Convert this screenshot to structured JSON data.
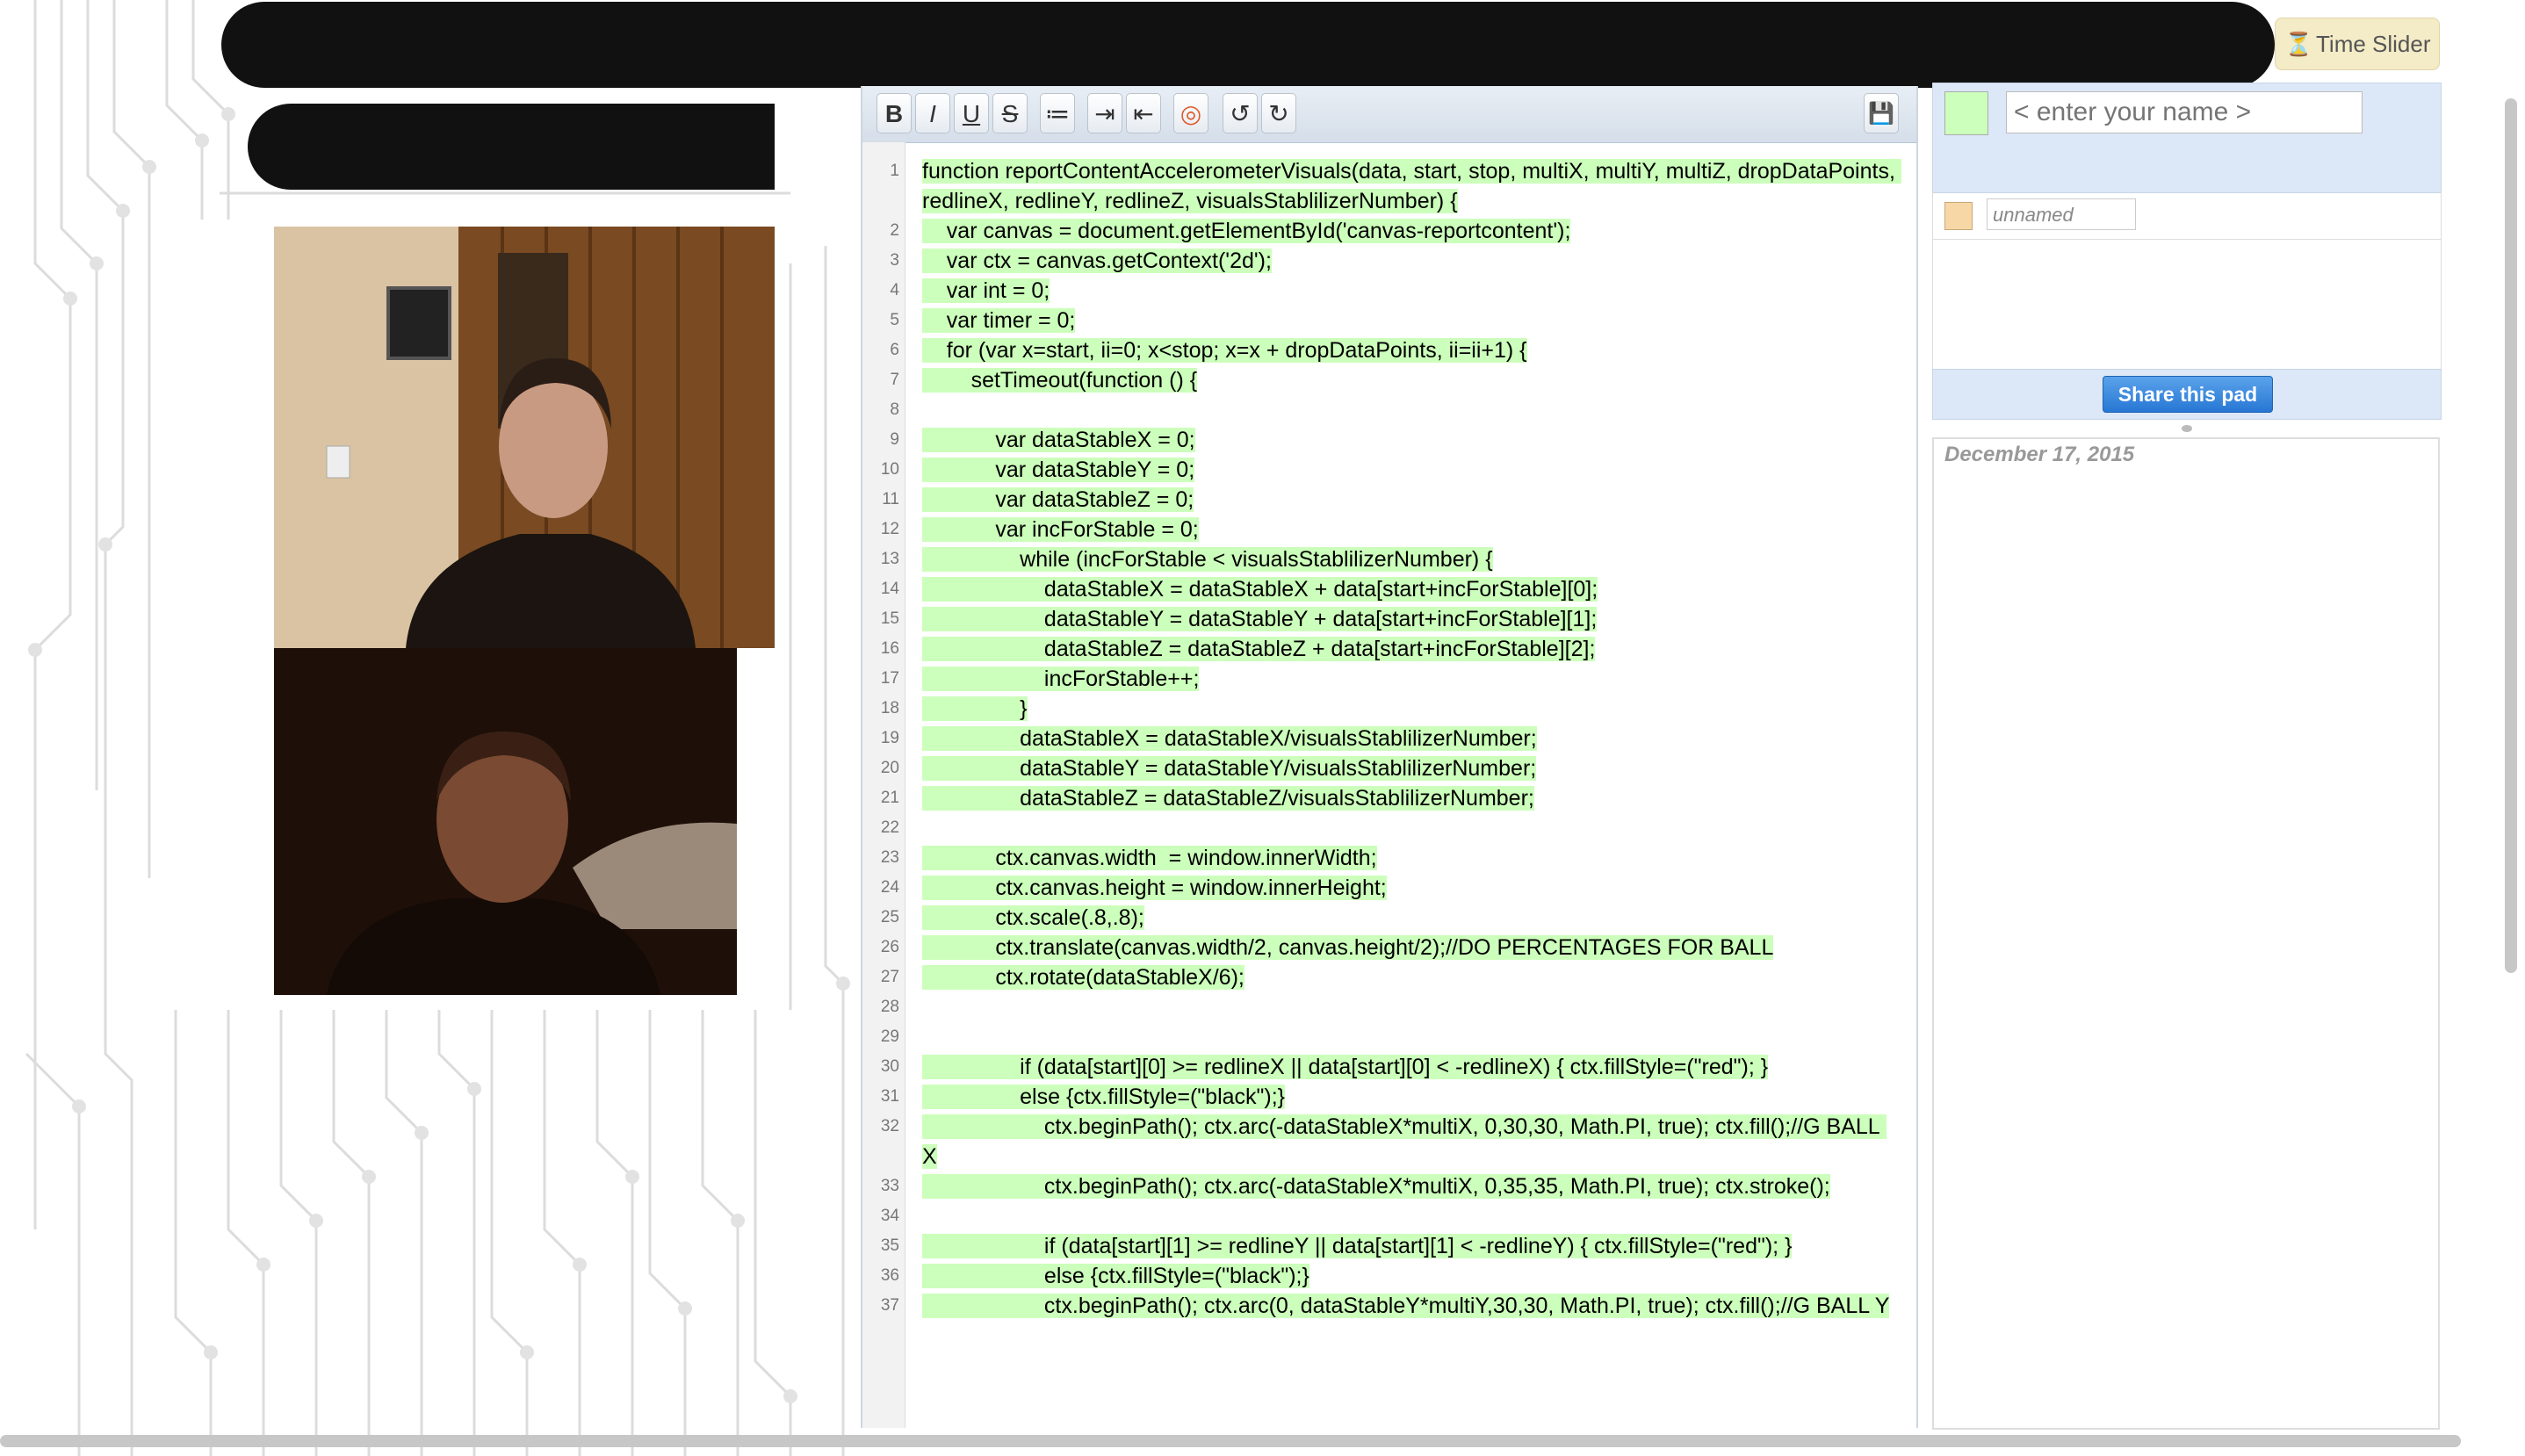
{
  "time_slider": {
    "label": "Time Slider"
  },
  "toolbar": {
    "buttons": [
      {
        "name": "bold",
        "glyph": "B"
      },
      {
        "name": "italic",
        "glyph": "I"
      },
      {
        "name": "underline",
        "glyph": "U"
      },
      {
        "name": "strikethrough",
        "glyph": "S"
      },
      {
        "name": "bullet-list",
        "glyph": "≔"
      },
      {
        "name": "indent",
        "glyph": "⇥"
      },
      {
        "name": "outdent",
        "glyph": "⇤"
      },
      {
        "name": "authorship-colors",
        "glyph": "◎"
      },
      {
        "name": "undo",
        "glyph": "↺"
      },
      {
        "name": "redo",
        "glyph": "↻"
      }
    ],
    "save_glyph": "💾"
  },
  "editor": {
    "lines": [
      {
        "n": "1",
        "text": "function reportContentAccelerometerVisuals(data, start, stop, multiX, multiY, multiZ, dropDataPoints, redlineX, redlineY, redlineZ, visualsStablilizerNumber) {"
      },
      {
        "n": "2",
        "text": "\tvar canvas = document.getElementById('canvas-reportcontent');"
      },
      {
        "n": "3",
        "text": "\tvar ctx = canvas.getContext('2d');"
      },
      {
        "n": "4",
        "text": "\tvar int = 0;"
      },
      {
        "n": "5",
        "text": "\tvar timer = 0;"
      },
      {
        "n": "6",
        "text": "\tfor (var x=start, ii=0; x<stop; x=x + dropDataPoints, ii=ii+1) {"
      },
      {
        "n": "7",
        "text": "\t\tsetTimeout(function () {"
      },
      {
        "n": "8",
        "text": ""
      },
      {
        "n": "9",
        "text": "\t\t\tvar dataStableX = 0;"
      },
      {
        "n": "10",
        "text": "\t\t\tvar dataStableY = 0;"
      },
      {
        "n": "11",
        "text": "\t\t\tvar dataStableZ = 0;"
      },
      {
        "n": "12",
        "text": "\t\t\tvar incForStable = 0;"
      },
      {
        "n": "13",
        "text": "\t\t\t\twhile (incForStable < visualsStablilizerNumber) {"
      },
      {
        "n": "14",
        "text": "\t\t\t\t\tdataStableX = dataStableX + data[start+incForStable][0];"
      },
      {
        "n": "15",
        "text": "\t\t\t\t\tdataStableY = dataStableY + data[start+incForStable][1];"
      },
      {
        "n": "16",
        "text": "\t\t\t\t\tdataStableZ = dataStableZ + data[start+incForStable][2];"
      },
      {
        "n": "17",
        "text": "\t\t\t\t\tincForStable++;"
      },
      {
        "n": "18",
        "text": "\t\t\t\t}"
      },
      {
        "n": "19",
        "text": "\t\t\t\tdataStableX = dataStableX/visualsStablilizerNumber;"
      },
      {
        "n": "20",
        "text": "\t\t\t\tdataStableY = dataStableY/visualsStablilizerNumber;"
      },
      {
        "n": "21",
        "text": "\t\t\t\tdataStableZ = dataStableZ/visualsStablilizerNumber;"
      },
      {
        "n": "22",
        "text": ""
      },
      {
        "n": "23",
        "text": "\t\t\tctx.canvas.width  = window.innerWidth;"
      },
      {
        "n": "24",
        "text": "\t\t\tctx.canvas.height = window.innerHeight;"
      },
      {
        "n": "25",
        "text": "\t\t\tctx.scale(.8,.8);"
      },
      {
        "n": "26",
        "text": "\t\t\tctx.translate(canvas.width/2, canvas.height/2);//DO PERCENTAGES FOR BALL"
      },
      {
        "n": "27",
        "text": "\t\t\tctx.rotate(dataStableX/6);"
      },
      {
        "n": "28",
        "text": ""
      },
      {
        "n": "29",
        "text": ""
      },
      {
        "n": "30",
        "text": "\t\t\t\tif (data[start][0] >= redlineX || data[start][0] < -redlineX) { ctx.fillStyle=(\"red\"); }"
      },
      {
        "n": "31",
        "text": "\t\t\t\telse {ctx.fillStyle=(\"black\");}"
      },
      {
        "n": "32",
        "text": "\t\t\t\t\tctx.beginPath(); ctx.arc(-dataStableX*multiX, 0,30,30, Math.PI, true); ctx.fill();//G BALL X"
      },
      {
        "n": "33",
        "text": "\t\t\t\t\tctx.beginPath(); ctx.arc(-dataStableX*multiX, 0,35,35, Math.PI, true); ctx.stroke();"
      },
      {
        "n": "34",
        "text": ""
      },
      {
        "n": "35",
        "text": "\t\t\t\t\tif (data[start][1] >= redlineY || data[start][1] < -redlineY) { ctx.fillStyle=(\"red\"); }"
      },
      {
        "n": "36",
        "text": "\t\t\t\t\telse {ctx.fillStyle=(\"black\");}"
      },
      {
        "n": "37",
        "text": "\t\t\t\t\tctx.beginPath(); ctx.arc(0, dataStableY*multiY,30,30, Math.PI, true); ctx.fill();//G BALL Y"
      }
    ]
  },
  "users": {
    "me_color": "#ccffbb",
    "name_placeholder": "< enter your name >",
    "other": {
      "name_placeholder": "unnamed",
      "color": "#f7d7a6"
    }
  },
  "share": {
    "label": "Share this pad"
  },
  "chat": {
    "date": "December 17, 2015"
  }
}
